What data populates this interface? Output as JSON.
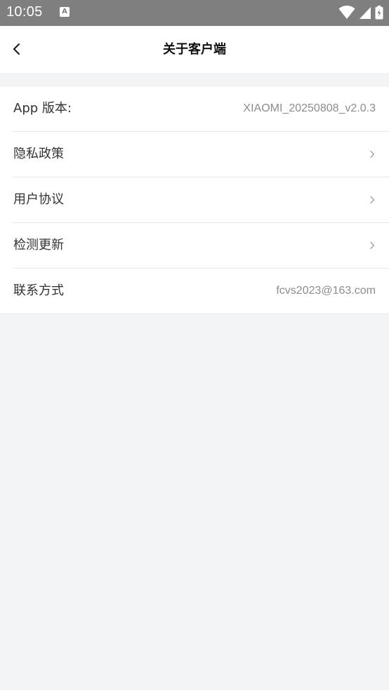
{
  "status_bar": {
    "time": "10:05",
    "notification_badge": "A",
    "icons": [
      "wifi-icon",
      "cell-signal-icon",
      "battery-charging-icon"
    ]
  },
  "header": {
    "title": "关于客户端",
    "back_icon": "chevron-left-icon"
  },
  "list": {
    "items": [
      {
        "label": "App 版本:",
        "value": "XIAOMI_20250808_v2.0.3",
        "has_chevron": false
      },
      {
        "label": "隐私政策",
        "value": "",
        "has_chevron": true
      },
      {
        "label": "用户协议",
        "value": "",
        "has_chevron": true
      },
      {
        "label": "检测更新",
        "value": "",
        "has_chevron": true
      },
      {
        "label": "联系方式",
        "value": "fcvs2023@163.com",
        "has_chevron": false
      }
    ]
  },
  "colors": {
    "status_bar_bg": "#7f7f7f",
    "page_bg": "#f3f4f6",
    "title_text": "#111111",
    "label_text": "#333333",
    "value_text": "#8c8c8c",
    "divider": "#e8e8e8"
  }
}
